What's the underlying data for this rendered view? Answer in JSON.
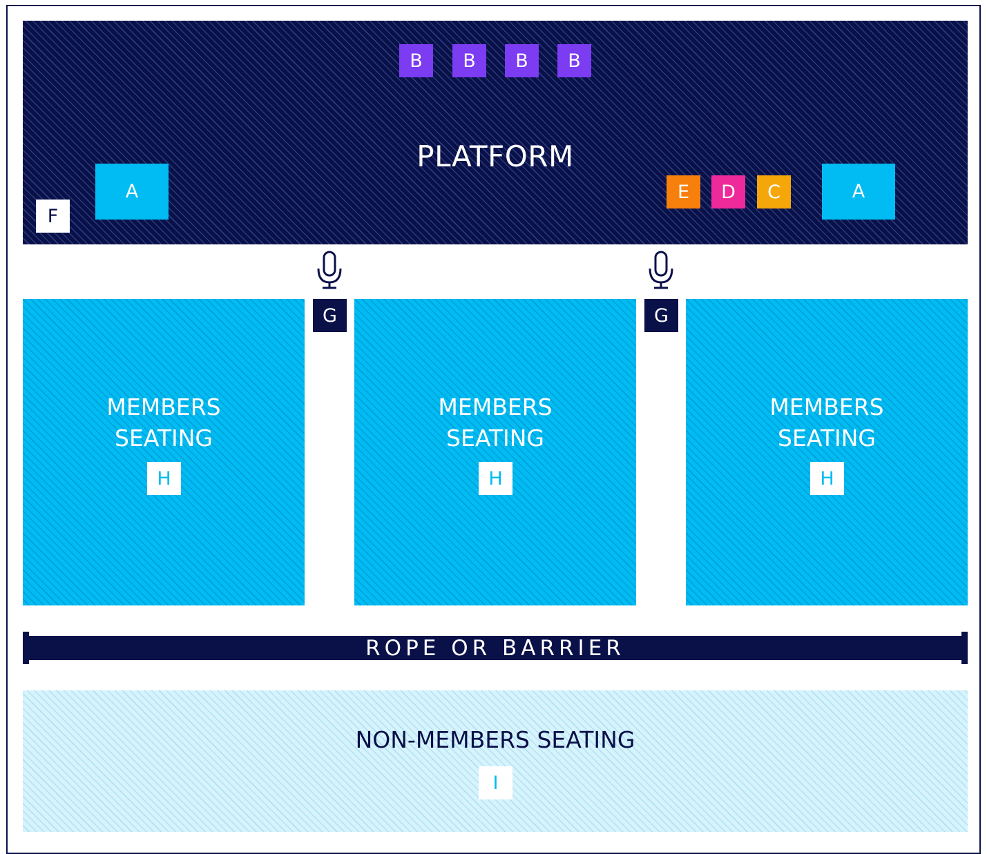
{
  "platform": {
    "title": "PLATFORM",
    "b_tags": [
      "B",
      "B",
      "B",
      "B"
    ],
    "a_left": "A",
    "a_right": "A",
    "f": "F",
    "e": "E",
    "d": "D",
    "c": "C"
  },
  "aisles": [
    {
      "icon": "microphone-icon",
      "label": "G"
    },
    {
      "icon": "microphone-icon",
      "label": "G"
    }
  ],
  "members_blocks": [
    {
      "title": "MEMBERS\nSEATING",
      "tag": "H"
    },
    {
      "title": "MEMBERS\nSEATING",
      "tag": "H"
    },
    {
      "title": "MEMBERS\nSEATING",
      "tag": "H"
    }
  ],
  "barrier": {
    "label": "ROPE OR BARRIER"
  },
  "non_members": {
    "title": "NON-MEMBERS SEATING",
    "tag": "I"
  },
  "colors": {
    "navy": "#0a1048",
    "cyan": "#00bcf2",
    "purple": "#7b3cf2",
    "orange": "#f7800c",
    "pink": "#ee2a9b",
    "amber": "#f5a70a",
    "light_cyan": "#d7f3fc"
  }
}
